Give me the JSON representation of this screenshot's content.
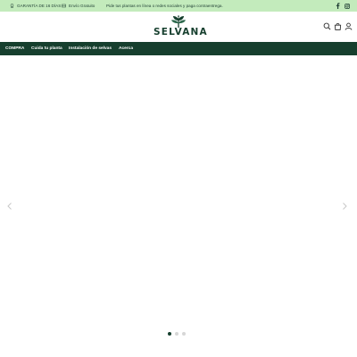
{
  "announcement": {
    "guarantee": "GARANTÍA DE 16 DÍAS",
    "shipping": "Envío Gratuito",
    "order_note": "Pide tus plantas en línea o redes sociales y paga contraentrega."
  },
  "social": {
    "facebook_icon": "facebook-icon",
    "instagram_icon": "instagram-icon"
  },
  "brand": {
    "name": "SELVANA",
    "accent": "#163f2e",
    "bar_color": "#c3ebbc"
  },
  "header_icons": [
    "search-icon",
    "bag-icon",
    "user-icon"
  ],
  "nav": {
    "items": [
      "COMPRA",
      "Cuida tu planta",
      "Instalación de selvas",
      "Acerca"
    ]
  },
  "slider": {
    "slide_count": 3,
    "active_index": 1
  }
}
